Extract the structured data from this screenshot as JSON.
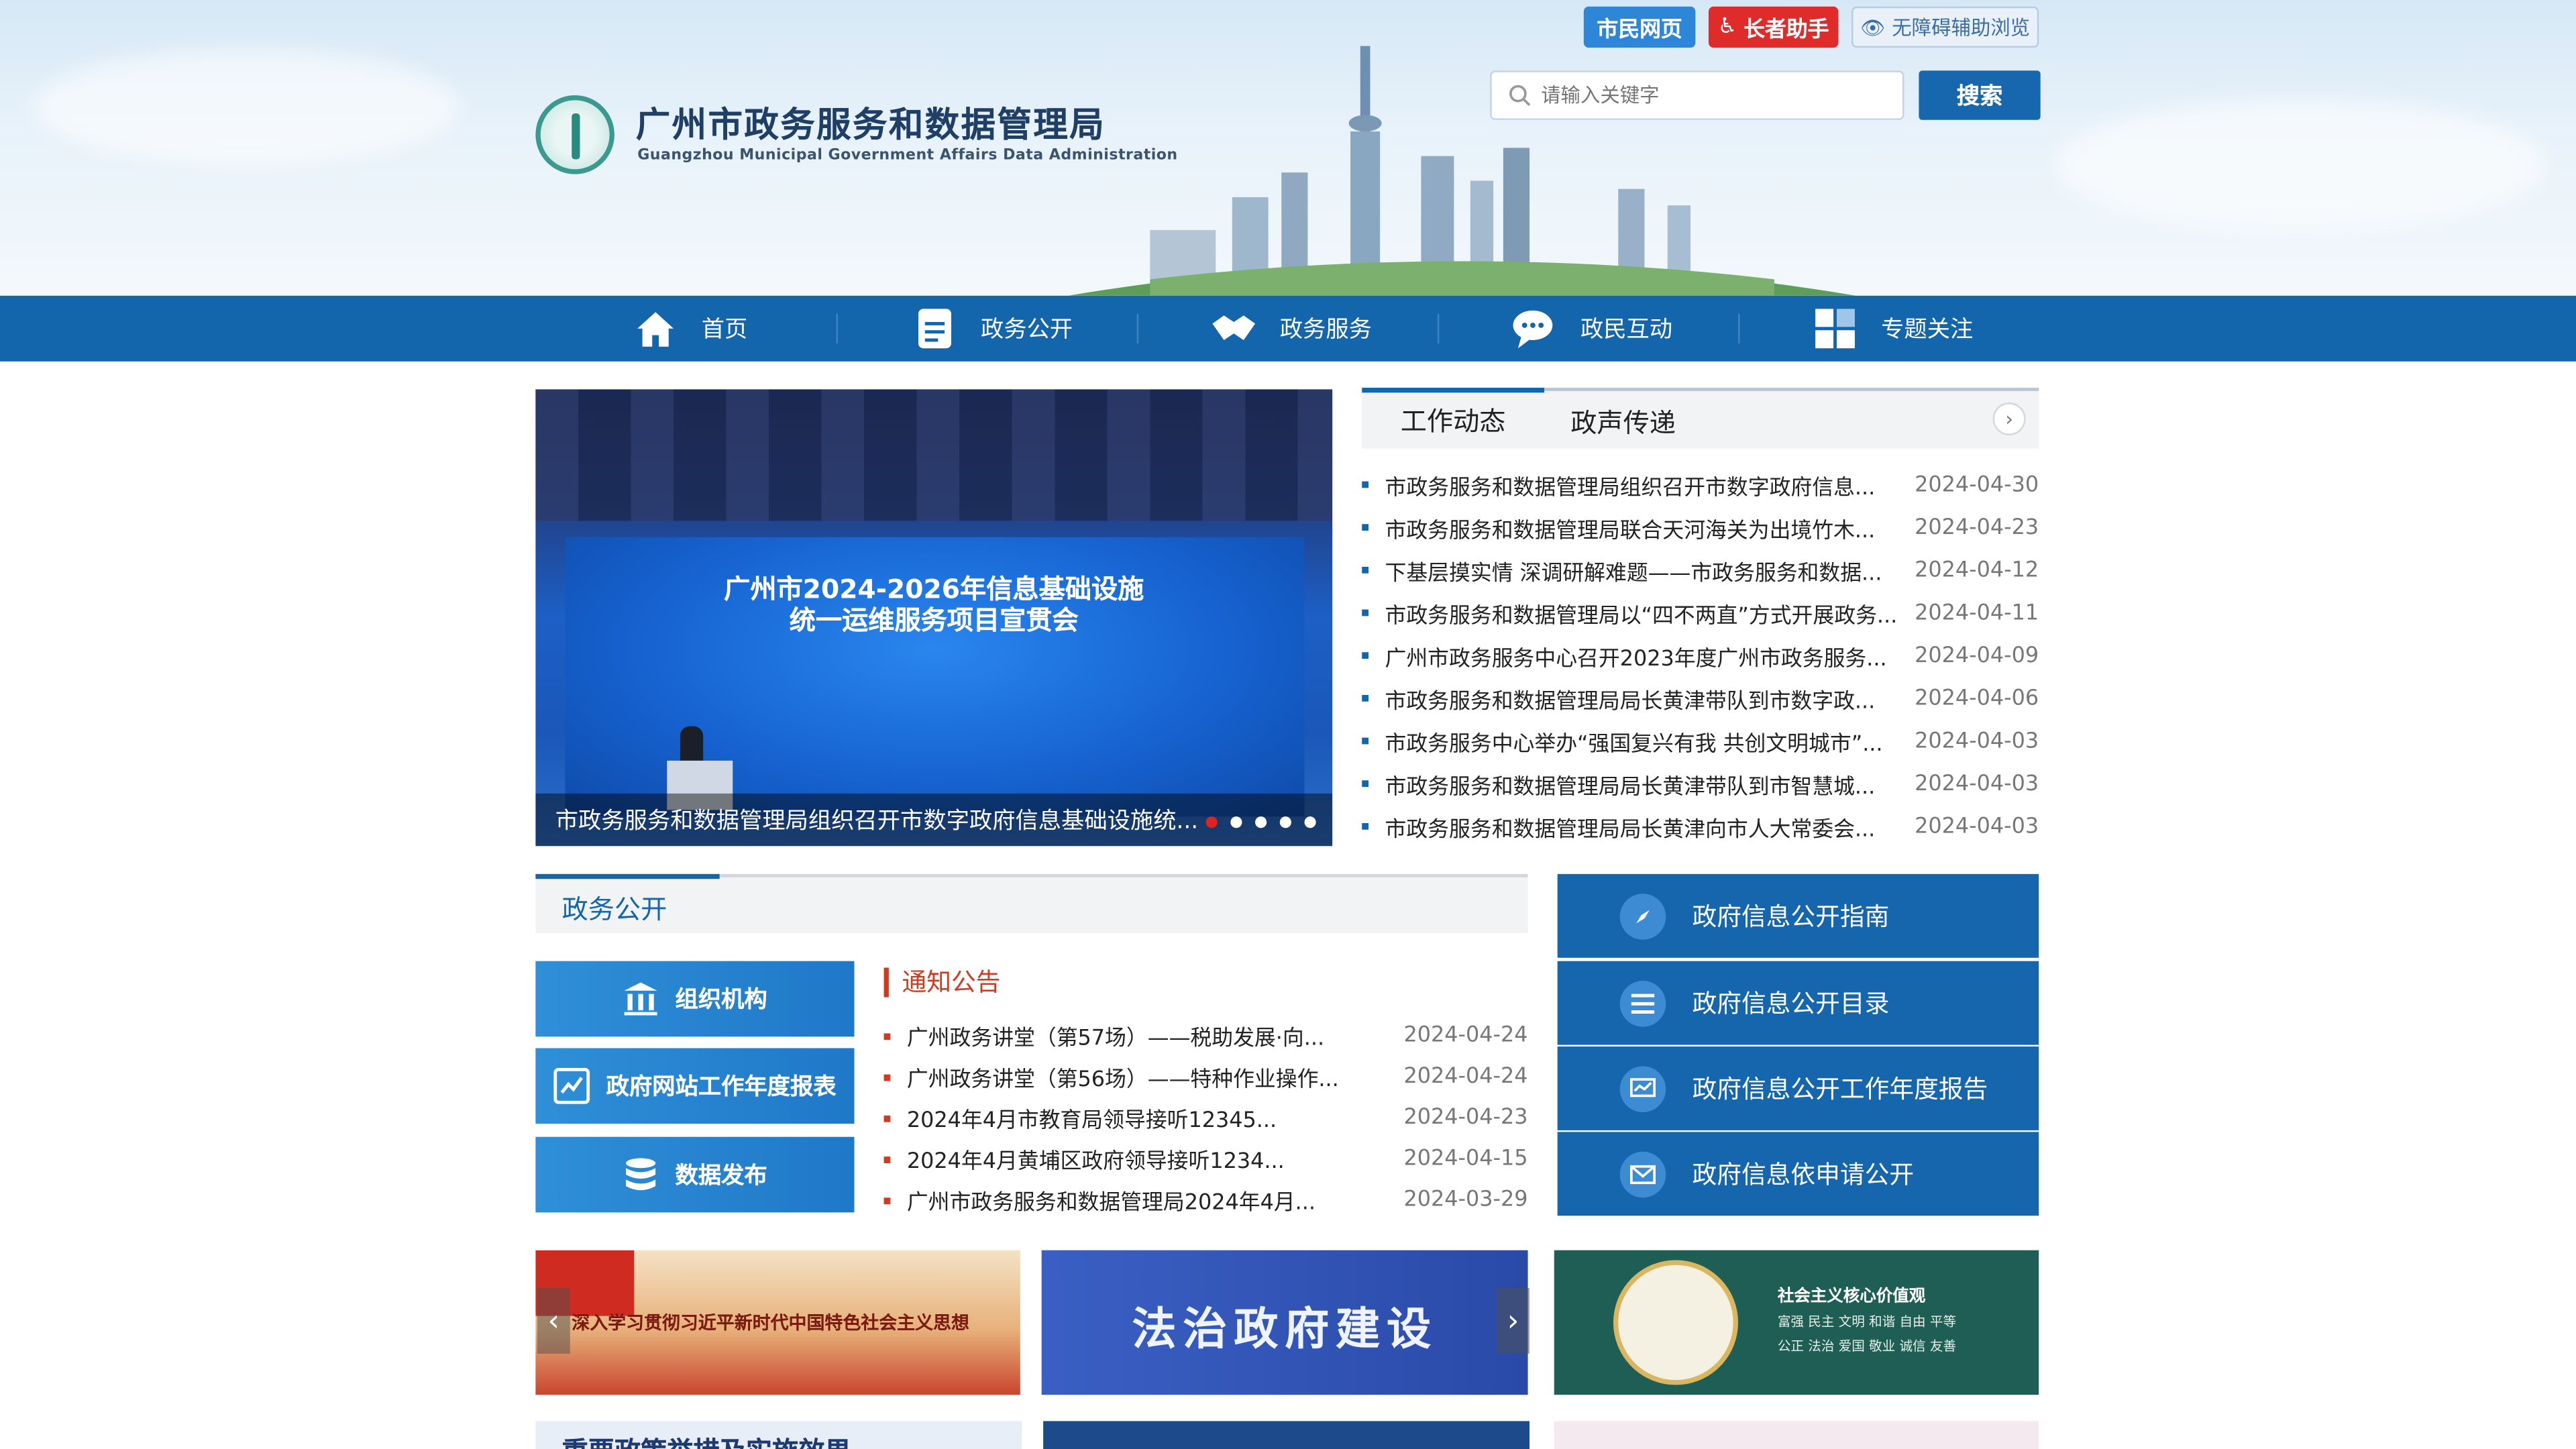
{
  "header": {
    "title": "广州市政务服务和数据管理局",
    "subtitle": "Guangzhou Municipal Government Affairs Data Administration",
    "top_buttons": [
      "市民网页",
      "长者助手",
      "无障碍辅助浏览"
    ],
    "search_placeholder": "请输入关键字",
    "search_button": "搜索"
  },
  "nav": [
    "首页",
    "政务公开",
    "政务服务",
    "政民互动",
    "专题关注"
  ],
  "carousel": {
    "screen_title_line1": "广州市2024-2026年信息基础设施",
    "screen_title_line2": "统一运维服务项目宣贯会",
    "caption": "市政务服务和数据管理局组织召开市数字政府信息基础设施统..."
  },
  "news_tabs": [
    "工作动态",
    "政声传递"
  ],
  "news": [
    {
      "title": "市政务服务和数据管理局组织召开市数字政府信息...",
      "date": "2024-04-30"
    },
    {
      "title": "市政务服务和数据管理局联合天河海关为出境竹木...",
      "date": "2024-04-23"
    },
    {
      "title": "下基层摸实情 深调研解难题——市政务服务和数据...",
      "date": "2024-04-12"
    },
    {
      "title": "市政务服务和数据管理局以“四不两直”方式开展政务...",
      "date": "2024-04-11"
    },
    {
      "title": "广州市政务服务中心召开2023年度广州市政务服务...",
      "date": "2024-04-09"
    },
    {
      "title": "市政务服务和数据管理局局长黄津带队到市数字政...",
      "date": "2024-04-06"
    },
    {
      "title": "市政务服务中心举办“强国复兴有我 共创文明城市”...",
      "date": "2024-04-03"
    },
    {
      "title": "市政务服务和数据管理局局长黄津带队到市智慧城...",
      "date": "2024-04-03"
    },
    {
      "title": "市政务服务和数据管理局局长黄津向市人大常委会...",
      "date": "2024-04-03"
    }
  ],
  "gov_open": {
    "title": "政务公开",
    "quick_buttons": [
      "组织机构",
      "政府网站工作年度报表",
      "数据发布"
    ],
    "notice_title": "通知公告",
    "notices": [
      {
        "title": "广州政务讲堂（第57场）——税助发展·向...",
        "date": "2024-04-24"
      },
      {
        "title": "广州政务讲堂（第56场）——特种作业操作...",
        "date": "2024-04-24"
      },
      {
        "title": "2024年4月市教育局领导接听12345...",
        "date": "2024-04-23"
      },
      {
        "title": "2024年4月黄埔区政府领导接听1234...",
        "date": "2024-04-15"
      },
      {
        "title": "广州市政务服务和数据管理局2024年4月...",
        "date": "2024-03-29"
      }
    ]
  },
  "right_links": [
    "政府信息公开指南",
    "政府信息公开目录",
    "政府信息公开工作年度报告",
    "政府信息依申请公开"
  ],
  "banners": {
    "b1": "深入学习贯彻习近平新时代中国特色社会主义思想",
    "b2": "法治政府建设",
    "b3_title": "社会主义核心价值观",
    "b3_lines": "富强 民主 文明 和谐 自由 平等 公正 法治 爱国 敬业 诚信 友善",
    "bottom1": "重要政策举措及实施效果"
  }
}
